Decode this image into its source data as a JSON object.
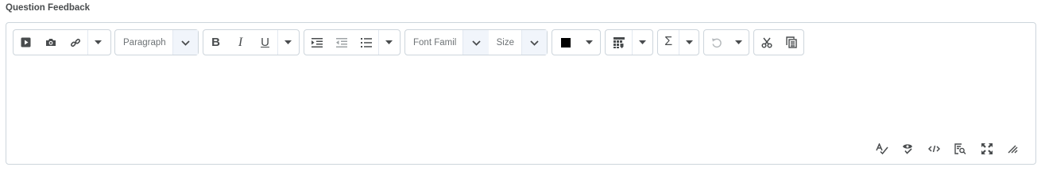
{
  "field_label": "Question Feedback",
  "toolbar": {
    "insert_stuff_icon": "play-icon",
    "insert_quicklink_icon": "camera-icon",
    "link_icon": "link-icon",
    "format_select": {
      "value": "Paragraph"
    },
    "bold_label": "B",
    "italic_label": "I",
    "underline_label": "U",
    "font_family_select": {
      "value": "Font Famil"
    },
    "font_size_select": {
      "value": "Size"
    },
    "text_color": "#000000",
    "equation_label": "Σ"
  },
  "bottom_tools": [
    "spellcheck-icon",
    "accessibility-checker-icon",
    "source-code-icon",
    "preview-icon",
    "fullscreen-icon",
    "resize-handle-icon"
  ],
  "colors": {
    "border": "#cdd5dc",
    "text": "#494c4e",
    "select_caret_bg": "#f1f5fb"
  }
}
